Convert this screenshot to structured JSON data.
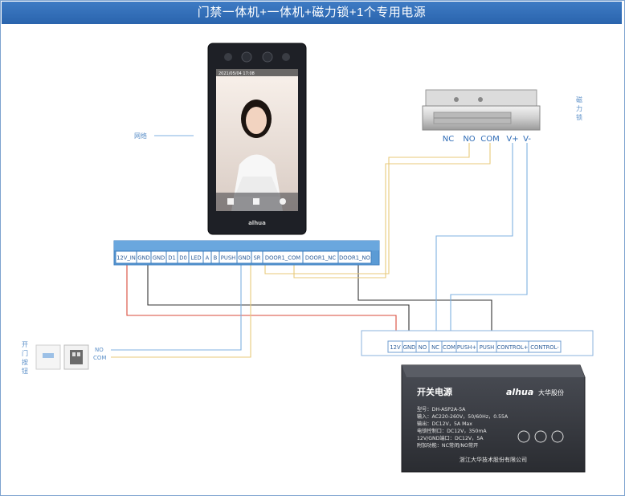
{
  "title": "门禁一体机+一体机+磁力锁+1个专用电源",
  "device": {
    "network_label": "网络",
    "screen_date": "2021/05/04 17:08",
    "brand": "alhua"
  },
  "lock": {
    "label_chars": [
      "磁",
      "力",
      "锁"
    ],
    "terminals": [
      "NC",
      "NO",
      "COM",
      "V+",
      "V-"
    ]
  },
  "controller_terminals": [
    "12V_IN",
    "GND",
    "GND",
    "D1",
    "D0",
    "LED",
    "A",
    "B",
    "PUSH",
    "GND",
    "SR",
    "DOOR1_COM",
    "DOOR1_NC",
    "DOOR1_NO"
  ],
  "button": {
    "label_chars": [
      "开",
      "门",
      "按",
      "钮"
    ],
    "no_label": "NO",
    "com_label": "COM"
  },
  "psu_terminals": [
    "12V",
    "GND",
    "NO",
    "NC",
    "COM",
    "PUSH+",
    "PUSH",
    "CONTROL+",
    "CONTROL-"
  ],
  "psu": {
    "name": "开关电源",
    "brand": "alhua",
    "brand_cn": "大华股份",
    "specs": [
      "型号：DH-ASP2A-5A",
      "输入：AC220-260V，50/60Hz，0.55A",
      "输出：DC12V，5A Max",
      "电锁控制口：DC12V，350mA",
      "12V/GND端口：DC12V，5A",
      "附加功能：NC常闭/NO常开"
    ],
    "maker": "浙江大华技术股份有限公司"
  },
  "colors": {
    "title_bg": "#2f6cb6",
    "terminal_blue": "#5b9bd5",
    "wire_red": "#d94a3a",
    "wire_black": "#333333",
    "wire_yellow": "#e8c97a",
    "wire_blue": "#7fb0e0"
  }
}
